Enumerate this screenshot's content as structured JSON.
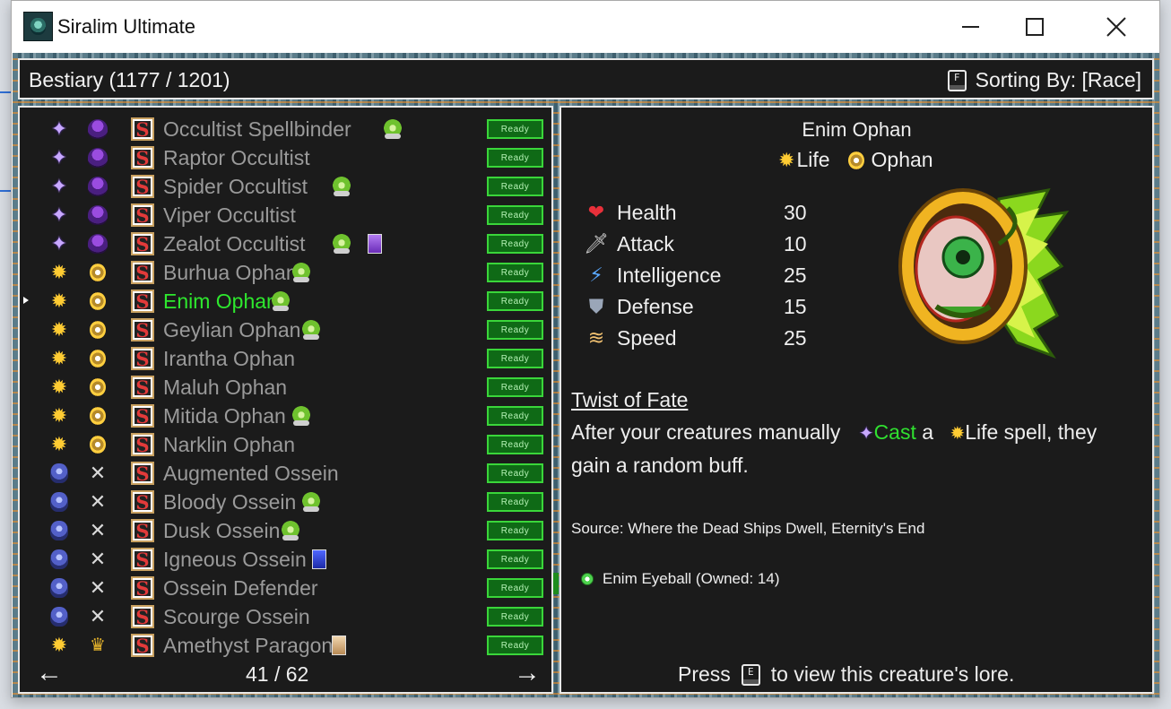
{
  "window": {
    "title": "Siralim Ultimate"
  },
  "header": {
    "title": "Bestiary (1177 / 1201)",
    "sort_key": "F",
    "sort_label": "Sorting By: [Race]"
  },
  "list": {
    "items": [
      {
        "name": "Occultist Spellbinder",
        "class_icon": "sorcery-icon",
        "race_icon": "occultist-icon",
        "extra": "goblin",
        "status": "Ready"
      },
      {
        "name": "Raptor Occultist",
        "class_icon": "sorcery-icon",
        "race_icon": "occultist-icon",
        "extra": "",
        "status": "Ready"
      },
      {
        "name": "Spider Occultist",
        "class_icon": "sorcery-icon",
        "race_icon": "occultist-icon",
        "extra": "goblin",
        "status": "Ready"
      },
      {
        "name": "Viper Occultist",
        "class_icon": "sorcery-icon",
        "race_icon": "occultist-icon",
        "extra": "",
        "status": "Ready"
      },
      {
        "name": "Zealot Occultist",
        "class_icon": "sorcery-icon",
        "race_icon": "occultist-icon",
        "extra": "goblin+card-purple",
        "status": "Ready"
      },
      {
        "name": "Burhua Ophan",
        "class_icon": "life-icon",
        "race_icon": "ophan-icon",
        "extra": "goblin",
        "status": "Ready"
      },
      {
        "name": "Enim Ophan",
        "class_icon": "life-icon",
        "race_icon": "ophan-icon",
        "extra": "goblin",
        "status": "Ready",
        "selected": true
      },
      {
        "name": "Geylian Ophan",
        "class_icon": "life-icon",
        "race_icon": "ophan-icon",
        "extra": "goblin",
        "status": "Ready"
      },
      {
        "name": "Irantha Ophan",
        "class_icon": "life-icon",
        "race_icon": "ophan-icon",
        "extra": "",
        "status": "Ready"
      },
      {
        "name": "Maluh Ophan",
        "class_icon": "life-icon",
        "race_icon": "ophan-icon",
        "extra": "",
        "status": "Ready"
      },
      {
        "name": "Mitida Ophan",
        "class_icon": "life-icon",
        "race_icon": "ophan-icon",
        "extra": "goblin",
        "status": "Ready"
      },
      {
        "name": "Narklin Ophan",
        "class_icon": "life-icon",
        "race_icon": "ophan-icon",
        "extra": "",
        "status": "Ready"
      },
      {
        "name": "Augmented Ossein",
        "class_icon": "death-icon",
        "race_icon": "ossein-icon",
        "extra": "",
        "status": "Ready"
      },
      {
        "name": "Bloody Ossein",
        "class_icon": "death-icon",
        "race_icon": "ossein-icon",
        "extra": "goblin",
        "status": "Ready"
      },
      {
        "name": "Dusk Ossein",
        "class_icon": "death-icon",
        "race_icon": "ossein-icon",
        "extra": "goblin",
        "status": "Ready"
      },
      {
        "name": "Igneous Ossein",
        "class_icon": "death-icon",
        "race_icon": "ossein-icon",
        "extra": "card-blue",
        "status": "Ready"
      },
      {
        "name": "Ossein Defender",
        "class_icon": "death-icon",
        "race_icon": "ossein-icon",
        "extra": "",
        "status": "Ready"
      },
      {
        "name": "Scourge Ossein",
        "class_icon": "death-icon",
        "race_icon": "ossein-icon",
        "extra": "",
        "status": "Ready"
      },
      {
        "name": "Amethyst Paragon",
        "class_icon": "life-icon",
        "race_icon": "paragon-icon",
        "extra": "card-tan",
        "status": "Ready"
      }
    ],
    "page": "41 / 62",
    "prev_arrow": "←",
    "next_arrow": "→"
  },
  "detail": {
    "name": "Enim Ophan",
    "class_label": "Life",
    "race_label": "Ophan",
    "stats": [
      {
        "label": "Health",
        "value": "30",
        "icon": "heart-icon"
      },
      {
        "label": "Attack",
        "value": "10",
        "icon": "sword-icon"
      },
      {
        "label": "Intelligence",
        "value": "25",
        "icon": "lightning-icon"
      },
      {
        "label": "Defense",
        "value": "15",
        "icon": "shield-icon"
      },
      {
        "label": "Speed",
        "value": "25",
        "icon": "wing-icon"
      }
    ],
    "ability_title": "Twist of Fate",
    "ability_text_1": "After your creatures manually",
    "ability_cast": "Cast",
    "ability_text_2": "a",
    "ability_life": "Life spell, they",
    "ability_text_3": "gain a random buff.",
    "source": "Source: Where the Dead Ships Dwell, Eternity's End",
    "material": "Enim Eyeball (Owned: 14)",
    "lore_press": "Press",
    "lore_key": "E",
    "lore_text": "to view this creature's lore."
  },
  "colors": {
    "selected": "#2ee82e",
    "ready_bg": "#0f6a16",
    "panel_bg": "#1b1b1b"
  }
}
